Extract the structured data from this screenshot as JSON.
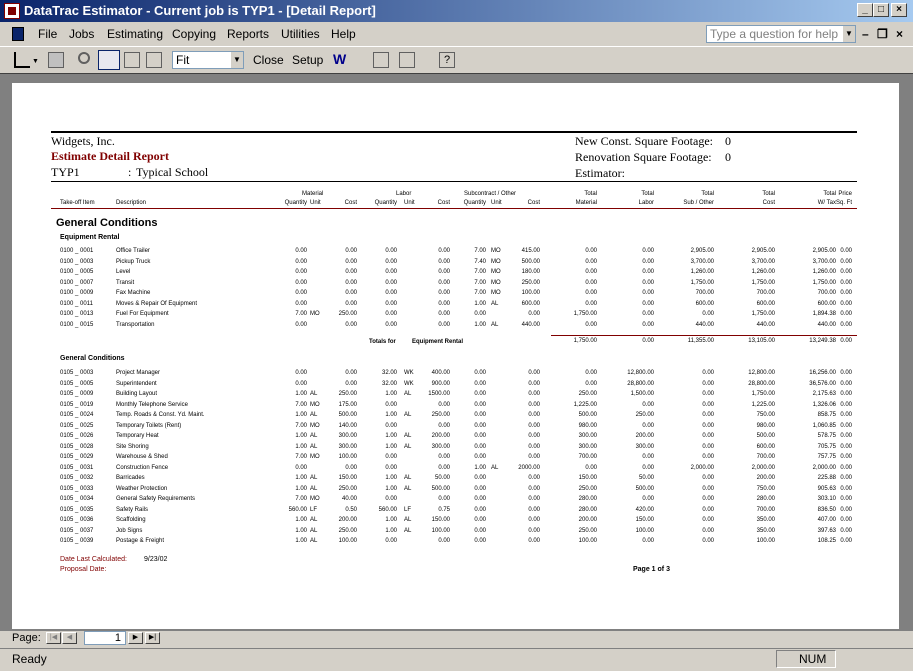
{
  "window": {
    "title": "DataTrac Estimator - Current job is TYP1 - [Detail Report]"
  },
  "menu": {
    "items": [
      "File",
      "Jobs",
      "Estimating",
      "Copying",
      "Reports",
      "Utilities",
      "Help"
    ],
    "help_placeholder": "Type a question for help"
  },
  "toolbar": {
    "zoom_value": "Fit",
    "close_label": "Close",
    "setup_label": "Setup"
  },
  "report": {
    "company": "Widgets, Inc.",
    "title": "Estimate Detail Report",
    "job_code": "TYP1",
    "job_sep": ":",
    "job_name": "Typical School",
    "new_const_label": "New Const. Square Footage:",
    "new_const_value": "0",
    "renovation_label": "Renovation Square Footage:",
    "renovation_value": "0",
    "estimator_label": "Estimator:",
    "col_groups": {
      "material": "Material",
      "labor": "Labor",
      "subcontract": "Subcontract / Other"
    },
    "col_headers": {
      "takeoff": "Take-off Item",
      "description": "Description",
      "m_qty": "Quantity",
      "m_unit": "Unit",
      "m_cost": "Cost",
      "l_qty": "Quantity",
      "l_unit": "Unit",
      "l_cost": "Cost",
      "s_qty": "Quantity",
      "s_unit": "Unit",
      "s_cost": "Cost",
      "tot_mat_1": "Total",
      "tot_mat_2": "Material",
      "tot_lab_1": "Total",
      "tot_lab_2": "Labor",
      "tot_sub_1": "Total",
      "tot_sub_2": "Sub / Other",
      "tot_cost_1": "Total",
      "tot_cost_2": "Cost",
      "tot_tax_1": "Total",
      "tot_tax_2": "W/ Tax",
      "price_1": "Price",
      "price_2": "Sq. Ft"
    },
    "section_title": "General Conditions",
    "group1_title": "Equipment Rental",
    "group1_rows": [
      [
        "0100 _ 0001",
        "Office Trailer",
        "0.00",
        "",
        "0.00",
        "0.00",
        "",
        "0.00",
        "7.00",
        "MO",
        "415.00",
        "0.00",
        "0.00",
        "2,905.00",
        "2,905.00",
        "2,905.00",
        "0.00"
      ],
      [
        "0100 _ 0003",
        "Pickup Truck",
        "0.00",
        "",
        "0.00",
        "0.00",
        "",
        "0.00",
        "7.40",
        "MO",
        "500.00",
        "0.00",
        "0.00",
        "3,700.00",
        "3,700.00",
        "3,700.00",
        "0.00"
      ],
      [
        "0100 _ 0005",
        "Level",
        "0.00",
        "",
        "0.00",
        "0.00",
        "",
        "0.00",
        "7.00",
        "MO",
        "180.00",
        "0.00",
        "0.00",
        "1,260.00",
        "1,260.00",
        "1,260.00",
        "0.00"
      ],
      [
        "0100 _ 0007",
        "Transit",
        "0.00",
        "",
        "0.00",
        "0.00",
        "",
        "0.00",
        "7.00",
        "MO",
        "250.00",
        "0.00",
        "0.00",
        "1,750.00",
        "1,750.00",
        "1,750.00",
        "0.00"
      ],
      [
        "0100 _ 0009",
        "Fax Machine",
        "0.00",
        "",
        "0.00",
        "0.00",
        "",
        "0.00",
        "7.00",
        "MO",
        "100.00",
        "0.00",
        "0.00",
        "700.00",
        "700.00",
        "700.00",
        "0.00"
      ],
      [
        "0100 _ 0011",
        "Moves & Repair Of Equipment",
        "0.00",
        "",
        "0.00",
        "0.00",
        "",
        "0.00",
        "1.00",
        "AL",
        "600.00",
        "0.00",
        "0.00",
        "600.00",
        "600.00",
        "600.00",
        "0.00"
      ],
      [
        "0100 _ 0013",
        "Fuel For Equipment",
        "7.00",
        "MO",
        "250.00",
        "0.00",
        "",
        "0.00",
        "0.00",
        "",
        "0.00",
        "1,750.00",
        "0.00",
        "0.00",
        "1,750.00",
        "1,894.38",
        "0.00"
      ],
      [
        "0100 _ 0015",
        "Transportation",
        "0.00",
        "",
        "0.00",
        "0.00",
        "",
        "0.00",
        "1.00",
        "AL",
        "440.00",
        "0.00",
        "0.00",
        "440.00",
        "440.00",
        "440.00",
        "0.00"
      ]
    ],
    "group1_totals_label": "Totals for",
    "group1_totals_name": "Equipment Rental",
    "group1_totals": [
      "1,750.00",
      "0.00",
      "11,355.00",
      "13,105.00",
      "13,249.38",
      "0.00"
    ],
    "group2_title": "General Conditions",
    "group2_rows": [
      [
        "0105 _ 0003",
        "Project Manager",
        "0.00",
        "",
        "0.00",
        "32.00",
        "WK",
        "400.00",
        "0.00",
        "",
        "0.00",
        "0.00",
        "12,800.00",
        "0.00",
        "12,800.00",
        "16,256.00",
        "0.00"
      ],
      [
        "0105 _ 0005",
        "Superintendent",
        "0.00",
        "",
        "0.00",
        "32.00",
        "WK",
        "900.00",
        "0.00",
        "",
        "0.00",
        "0.00",
        "28,800.00",
        "0.00",
        "28,800.00",
        "36,576.00",
        "0.00"
      ],
      [
        "0105 _ 0009",
        "Building Layout",
        "1.00",
        "AL",
        "250.00",
        "1.00",
        "AL",
        "1500.00",
        "0.00",
        "",
        "0.00",
        "250.00",
        "1,500.00",
        "0.00",
        "1,750.00",
        "2,175.63",
        "0.00"
      ],
      [
        "0105 _ 0019",
        "Monthly Telephone Service",
        "7.00",
        "MO",
        "175.00",
        "0.00",
        "",
        "0.00",
        "0.00",
        "",
        "0.00",
        "1,225.00",
        "0.00",
        "0.00",
        "1,225.00",
        "1,326.06",
        "0.00"
      ],
      [
        "0105 _ 0024",
        "Temp. Roads & Const. Yd. Maint.",
        "1.00",
        "AL",
        "500.00",
        "1.00",
        "AL",
        "250.00",
        "0.00",
        "",
        "0.00",
        "500.00",
        "250.00",
        "0.00",
        "750.00",
        "858.75",
        "0.00"
      ],
      [
        "0105 _ 0025",
        "Temporary Toilets (Rent)",
        "7.00",
        "MO",
        "140.00",
        "0.00",
        "",
        "0.00",
        "0.00",
        "",
        "0.00",
        "980.00",
        "0.00",
        "0.00",
        "980.00",
        "1,060.85",
        "0.00"
      ],
      [
        "0105 _ 0026",
        "Temporary Heat",
        "1.00",
        "AL",
        "300.00",
        "1.00",
        "AL",
        "200.00",
        "0.00",
        "",
        "0.00",
        "300.00",
        "200.00",
        "0.00",
        "500.00",
        "578.75",
        "0.00"
      ],
      [
        "0105 _ 0028",
        "Site Shoring",
        "1.00",
        "AL",
        "300.00",
        "1.00",
        "AL",
        "300.00",
        "0.00",
        "",
        "0.00",
        "300.00",
        "300.00",
        "0.00",
        "600.00",
        "705.75",
        "0.00"
      ],
      [
        "0105 _ 0029",
        "Warehouse & Shed",
        "7.00",
        "MO",
        "100.00",
        "0.00",
        "",
        "0.00",
        "0.00",
        "",
        "0.00",
        "700.00",
        "0.00",
        "0.00",
        "700.00",
        "757.75",
        "0.00"
      ],
      [
        "0105 _ 0031",
        "Construction Fence",
        "0.00",
        "",
        "0.00",
        "0.00",
        "",
        "0.00",
        "1.00",
        "AL",
        "2000.00",
        "0.00",
        "0.00",
        "2,000.00",
        "2,000.00",
        "2,000.00",
        "0.00"
      ],
      [
        "0105 _ 0032",
        "Barricades",
        "1.00",
        "AL",
        "150.00",
        "1.00",
        "AL",
        "50.00",
        "0.00",
        "",
        "0.00",
        "150.00",
        "50.00",
        "0.00",
        "200.00",
        "225.88",
        "0.00"
      ],
      [
        "0105 _ 0033",
        "Weather Protection",
        "1.00",
        "AL",
        "250.00",
        "1.00",
        "AL",
        "500.00",
        "0.00",
        "",
        "0.00",
        "250.00",
        "500.00",
        "0.00",
        "750.00",
        "905.63",
        "0.00"
      ],
      [
        "0105 _ 0034",
        "General Safety Requirements",
        "7.00",
        "MO",
        "40.00",
        "0.00",
        "",
        "0.00",
        "0.00",
        "",
        "0.00",
        "280.00",
        "0.00",
        "0.00",
        "280.00",
        "303.10",
        "0.00"
      ],
      [
        "0105 _ 0035",
        "Safety Rails",
        "560.00",
        "LF",
        "0.50",
        "560.00",
        "LF",
        "0.75",
        "0.00",
        "",
        "0.00",
        "280.00",
        "420.00",
        "0.00",
        "700.00",
        "836.50",
        "0.00"
      ],
      [
        "0105 _ 0036",
        "Scaffolding",
        "1.00",
        "AL",
        "200.00",
        "1.00",
        "AL",
        "150.00",
        "0.00",
        "",
        "0.00",
        "200.00",
        "150.00",
        "0.00",
        "350.00",
        "407.00",
        "0.00"
      ],
      [
        "0105 _ 0037",
        "Job Signs",
        "1.00",
        "AL",
        "250.00",
        "1.00",
        "AL",
        "100.00",
        "0.00",
        "",
        "0.00",
        "250.00",
        "100.00",
        "0.00",
        "350.00",
        "397.63",
        "0.00"
      ],
      [
        "0105 _ 0039",
        "Postage & Freight",
        "1.00",
        "AL",
        "100.00",
        "0.00",
        "",
        "0.00",
        "0.00",
        "",
        "0.00",
        "100.00",
        "0.00",
        "0.00",
        "100.00",
        "108.25",
        "0.00"
      ]
    ],
    "date_calc_label": "Date Last Calculated:",
    "date_calc_value": "9/23/02",
    "proposal_label": "Proposal Date:",
    "page_label": "Page 1 of 3"
  },
  "nav": {
    "page_label": "Page:",
    "page_value": "1"
  },
  "status": {
    "text": "Ready",
    "num": "NUM"
  }
}
